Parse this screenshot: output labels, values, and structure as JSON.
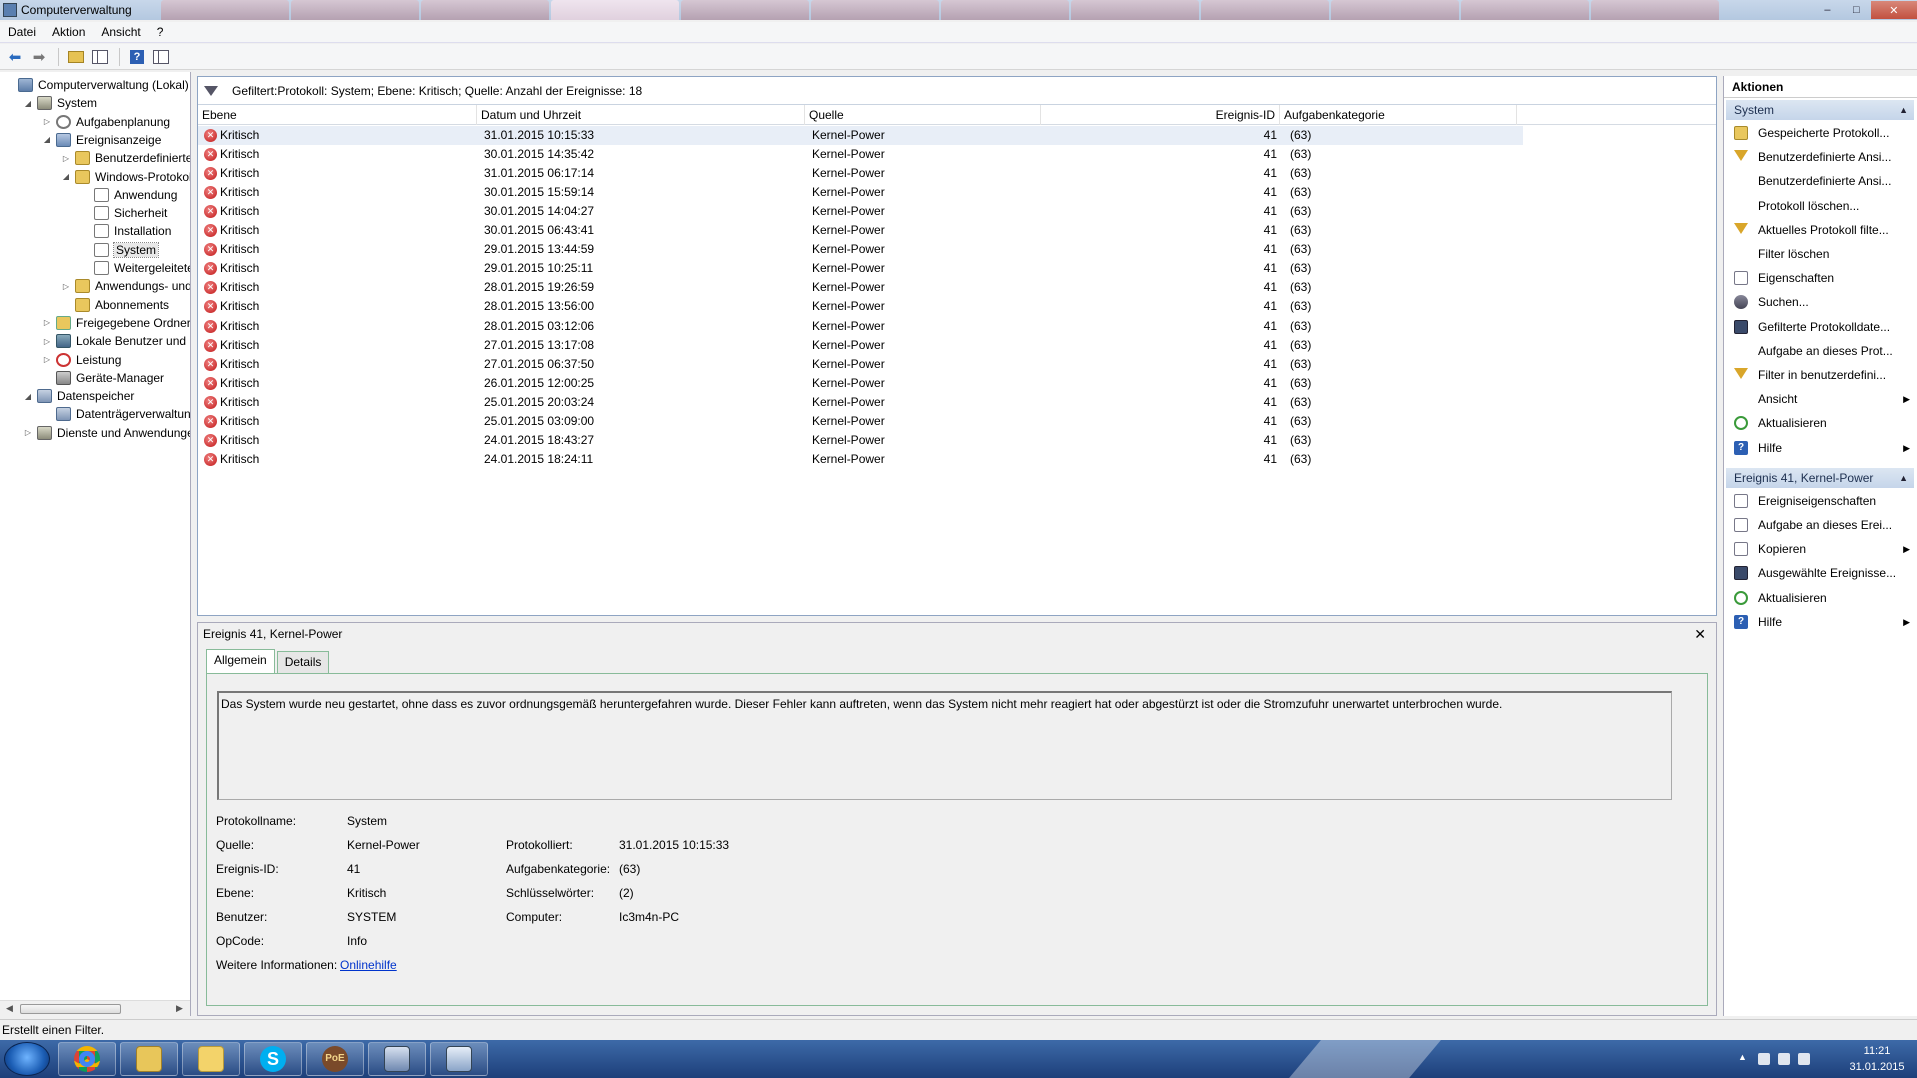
{
  "window": {
    "title": "Computerverwaltung",
    "browser_tabs": [
      "",
      "",
      "",
      "",
      "",
      "",
      "",
      "",
      "",
      "",
      "",
      ""
    ]
  },
  "menu": [
    "Datei",
    "Aktion",
    "Ansicht",
    "?"
  ],
  "tree": [
    {
      "label": "Computerverwaltung (Lokal)",
      "icon": "computer-management-icon",
      "level": 0,
      "expander": ""
    },
    {
      "label": "System",
      "icon": "system-tools-icon",
      "level": 1,
      "expander": "◢"
    },
    {
      "label": "Aufgabenplanung",
      "icon": "task-scheduler-icon",
      "level": 2,
      "expander": "▷"
    },
    {
      "label": "Ereignisanzeige",
      "icon": "event-viewer-icon",
      "level": 2,
      "expander": "◢"
    },
    {
      "label": "Benutzerdefinierte A",
      "icon": "folder-icon",
      "level": 3,
      "expander": "▷"
    },
    {
      "label": "Windows-Protokolle",
      "icon": "folder-icon",
      "level": 3,
      "expander": "◢"
    },
    {
      "label": "Anwendung",
      "icon": "log-icon",
      "level": 4,
      "expander": ""
    },
    {
      "label": "Sicherheit",
      "icon": "log-icon",
      "level": 4,
      "expander": ""
    },
    {
      "label": "Installation",
      "icon": "log-icon",
      "level": 4,
      "expander": ""
    },
    {
      "label": "System",
      "icon": "log-icon",
      "level": 4,
      "expander": "",
      "selected": true
    },
    {
      "label": "Weitergeleitete E",
      "icon": "log-icon",
      "level": 4,
      "expander": ""
    },
    {
      "label": "Anwendungs- und D",
      "icon": "folder-icon",
      "level": 3,
      "expander": "▷"
    },
    {
      "label": "Abonnements",
      "icon": "subscriptions-icon",
      "level": 3,
      "expander": ""
    },
    {
      "label": "Freigegebene Ordner",
      "icon": "shared-folder-icon",
      "level": 2,
      "expander": "▷"
    },
    {
      "label": "Lokale Benutzer und Gr",
      "icon": "users-icon",
      "level": 2,
      "expander": "▷"
    },
    {
      "label": "Leistung",
      "icon": "performance-icon",
      "level": 2,
      "expander": "▷"
    },
    {
      "label": "Geräte-Manager",
      "icon": "device-manager-icon",
      "level": 2,
      "expander": ""
    },
    {
      "label": "Datenspeicher",
      "icon": "storage-icon",
      "level": 1,
      "expander": "◢"
    },
    {
      "label": "Datenträgerverwaltung",
      "icon": "disk-management-icon",
      "level": 2,
      "expander": ""
    },
    {
      "label": "Dienste und Anwendungen",
      "icon": "services-icon",
      "level": 1,
      "expander": "▷"
    }
  ],
  "filter_text": "Gefiltert:Protokoll: System; Ebene: Kritisch; Quelle:  Anzahl der Ereignisse: 18",
  "columns": [
    "Ebene",
    "Datum und Uhrzeit",
    "Quelle",
    "Ereignis-ID",
    "Aufgabenkategorie"
  ],
  "events": [
    {
      "level": "Kritisch",
      "datetime": "31.01.2015 10:15:33",
      "source": "Kernel-Power",
      "id": "41",
      "category": "(63)"
    },
    {
      "level": "Kritisch",
      "datetime": "30.01.2015 14:35:42",
      "source": "Kernel-Power",
      "id": "41",
      "category": "(63)"
    },
    {
      "level": "Kritisch",
      "datetime": "31.01.2015 06:17:14",
      "source": "Kernel-Power",
      "id": "41",
      "category": "(63)"
    },
    {
      "level": "Kritisch",
      "datetime": "30.01.2015 15:59:14",
      "source": "Kernel-Power",
      "id": "41",
      "category": "(63)"
    },
    {
      "level": "Kritisch",
      "datetime": "30.01.2015 14:04:27",
      "source": "Kernel-Power",
      "id": "41",
      "category": "(63)"
    },
    {
      "level": "Kritisch",
      "datetime": "30.01.2015 06:43:41",
      "source": "Kernel-Power",
      "id": "41",
      "category": "(63)"
    },
    {
      "level": "Kritisch",
      "datetime": "29.01.2015 13:44:59",
      "source": "Kernel-Power",
      "id": "41",
      "category": "(63)"
    },
    {
      "level": "Kritisch",
      "datetime": "29.01.2015 10:25:11",
      "source": "Kernel-Power",
      "id": "41",
      "category": "(63)"
    },
    {
      "level": "Kritisch",
      "datetime": "28.01.2015 19:26:59",
      "source": "Kernel-Power",
      "id": "41",
      "category": "(63)"
    },
    {
      "level": "Kritisch",
      "datetime": "28.01.2015 13:56:00",
      "source": "Kernel-Power",
      "id": "41",
      "category": "(63)"
    },
    {
      "level": "Kritisch",
      "datetime": "28.01.2015 03:12:06",
      "source": "Kernel-Power",
      "id": "41",
      "category": "(63)"
    },
    {
      "level": "Kritisch",
      "datetime": "27.01.2015 13:17:08",
      "source": "Kernel-Power",
      "id": "41",
      "category": "(63)"
    },
    {
      "level": "Kritisch",
      "datetime": "27.01.2015 06:37:50",
      "source": "Kernel-Power",
      "id": "41",
      "category": "(63)"
    },
    {
      "level": "Kritisch",
      "datetime": "26.01.2015 12:00:25",
      "source": "Kernel-Power",
      "id": "41",
      "category": "(63)"
    },
    {
      "level": "Kritisch",
      "datetime": "25.01.2015 20:03:24",
      "source": "Kernel-Power",
      "id": "41",
      "category": "(63)"
    },
    {
      "level": "Kritisch",
      "datetime": "25.01.2015 03:09:00",
      "source": "Kernel-Power",
      "id": "41",
      "category": "(63)"
    },
    {
      "level": "Kritisch",
      "datetime": "24.01.2015 18:43:27",
      "source": "Kernel-Power",
      "id": "41",
      "category": "(63)"
    },
    {
      "level": "Kritisch",
      "datetime": "24.01.2015 18:24:11",
      "source": "Kernel-Power",
      "id": "41",
      "category": "(63)"
    }
  ],
  "detail": {
    "title": "Ereignis 41, Kernel-Power",
    "close": "✕",
    "tabs": [
      "Allgemein",
      "Details"
    ],
    "description": "Das System wurde neu gestartet, ohne dass es zuvor ordnungsgemäß heruntergefahren wurde. Dieser Fehler kann auftreten, wenn das System nicht mehr reagiert hat oder abgestürzt ist oder die Stromzufuhr unerwartet unterbrochen wurde.",
    "fields": {
      "protokollname_label": "Protokollname:",
      "protokollname": "System",
      "quelle_label": "Quelle:",
      "quelle": "Kernel-Power",
      "protokolliert_label": "Protokolliert:",
      "protokolliert": "31.01.2015 10:15:33",
      "ereignisid_label": "Ereignis-ID:",
      "ereignisid": "41",
      "aufgabenkategorie_label": "Aufgabenkategorie:",
      "aufgabenkategorie": "(63)",
      "ebene_label": "Ebene:",
      "ebene": "Kritisch",
      "schluesselwoerter_label": "Schlüsselwörter:",
      "schluesselwoerter": "(2)",
      "benutzer_label": "Benutzer:",
      "benutzer": "SYSTEM",
      "computer_label": "Computer:",
      "computer": "Ic3m4n-PC",
      "opcode_label": "OpCode:",
      "opcode": "Info",
      "weitere_label": "Weitere Informationen:",
      "weitere_link": "Onlinehilfe"
    }
  },
  "actions": {
    "title": "Aktionen",
    "group1": "System",
    "group1_items": [
      {
        "label": "Gespeicherte Protokoll...",
        "icon": "open-log-icon",
        "submenu": false
      },
      {
        "label": "Benutzerdefinierte Ansi...",
        "icon": "filter-icon",
        "submenu": false
      },
      {
        "label": "Benutzerdefinierte Ansi...",
        "icon": "",
        "submenu": false
      },
      {
        "label": "Protokoll löschen...",
        "icon": "",
        "submenu": false
      },
      {
        "label": "Aktuelles Protokoll filte...",
        "icon": "filter-icon",
        "submenu": false
      },
      {
        "label": "Filter löschen",
        "icon": "",
        "submenu": false
      },
      {
        "label": "Eigenschaften",
        "icon": "properties-icon",
        "submenu": false
      },
      {
        "label": "Suchen...",
        "icon": "binoculars-icon",
        "submenu": false
      },
      {
        "label": "Gefilterte Protokolldate...",
        "icon": "save-icon",
        "submenu": false
      },
      {
        "label": "Aufgabe an dieses Prot...",
        "icon": "",
        "submenu": false
      },
      {
        "label": "Filter in benutzerdefini...",
        "icon": "filter-icon",
        "submenu": false
      },
      {
        "label": "Ansicht",
        "icon": "",
        "submenu": true
      },
      {
        "label": "Aktualisieren",
        "icon": "refresh-icon",
        "submenu": false
      },
      {
        "label": "Hilfe",
        "icon": "help-icon",
        "submenu": true
      }
    ],
    "group2": "Ereignis 41, Kernel-Power",
    "group2_items": [
      {
        "label": "Ereigniseigenschaften",
        "icon": "properties-icon",
        "submenu": false
      },
      {
        "label": "Aufgabe an dieses Erei...",
        "icon": "task-icon",
        "submenu": false
      },
      {
        "label": "Kopieren",
        "icon": "copy-icon",
        "submenu": true
      },
      {
        "label": "Ausgewählte Ereignisse...",
        "icon": "save-icon",
        "submenu": false
      },
      {
        "label": "Aktualisieren",
        "icon": "refresh-icon",
        "submenu": false
      },
      {
        "label": "Hilfe",
        "icon": "help-icon",
        "submenu": true
      }
    ]
  },
  "status": "Erstellt einen Filter.",
  "taskbar": {
    "apps": [
      "chrome-icon",
      "explorer-icon",
      "folder-icon",
      "skype-icon",
      "game-icon",
      "network-icon",
      "computer-management-icon"
    ],
    "skype_glyph": "S",
    "game_glyph": "PoE",
    "time": "11:21",
    "date": "31.01.2015"
  }
}
